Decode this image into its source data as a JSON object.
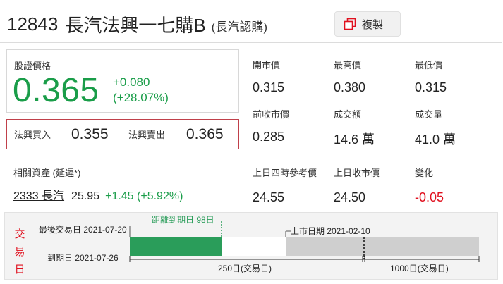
{
  "header": {
    "code": "12843",
    "name": "長汽法興一七購B",
    "sub": "(長汽認購)",
    "copy_label": "複製"
  },
  "price": {
    "label": "股證價格",
    "value": "0.365",
    "change": "+0.080",
    "change_pct": "(+28.07%)"
  },
  "bidask": {
    "bid_label": "法興買入",
    "bid_value": "0.355",
    "ask_label": "法興賣出",
    "ask_value": "0.365"
  },
  "stats": {
    "open": {
      "label": "開市價",
      "value": "0.315"
    },
    "high": {
      "label": "最高價",
      "value": "0.380"
    },
    "low": {
      "label": "最低價",
      "value": "0.315"
    },
    "prev_close": {
      "label": "前收市價",
      "value": "0.285"
    },
    "turnover": {
      "label": "成交額",
      "value": "14.6 萬"
    },
    "volume": {
      "label": "成交量",
      "value": "41.0 萬"
    },
    "ref_4pm": {
      "label": "上日四時參考價",
      "value": "24.55"
    },
    "prev_day_close": {
      "label": "上日收市價",
      "value": "24.50"
    },
    "change": {
      "label": "變化",
      "value": "-0.05"
    }
  },
  "related": {
    "label": "相關資產 (延遲*)",
    "link": "2333 長汽",
    "price": "25.95",
    "change": "+1.45 (+5.92%)"
  },
  "timeline": {
    "title": "交易日",
    "last_trade": "最後交易日 2021-07-20",
    "days_to_expiry": "距離到期日 98日",
    "listing": "上市日期 2021-02-10",
    "expiry": "到期日 2021-07-26",
    "tick_250": "250日(交易日)",
    "tick_1000": "1000日(交易日)",
    "colors": {
      "elapsed": "#2a9d5a",
      "remaining": "#ffffff",
      "after": "#cfcfcf",
      "title": "#e0101e"
    }
  }
}
